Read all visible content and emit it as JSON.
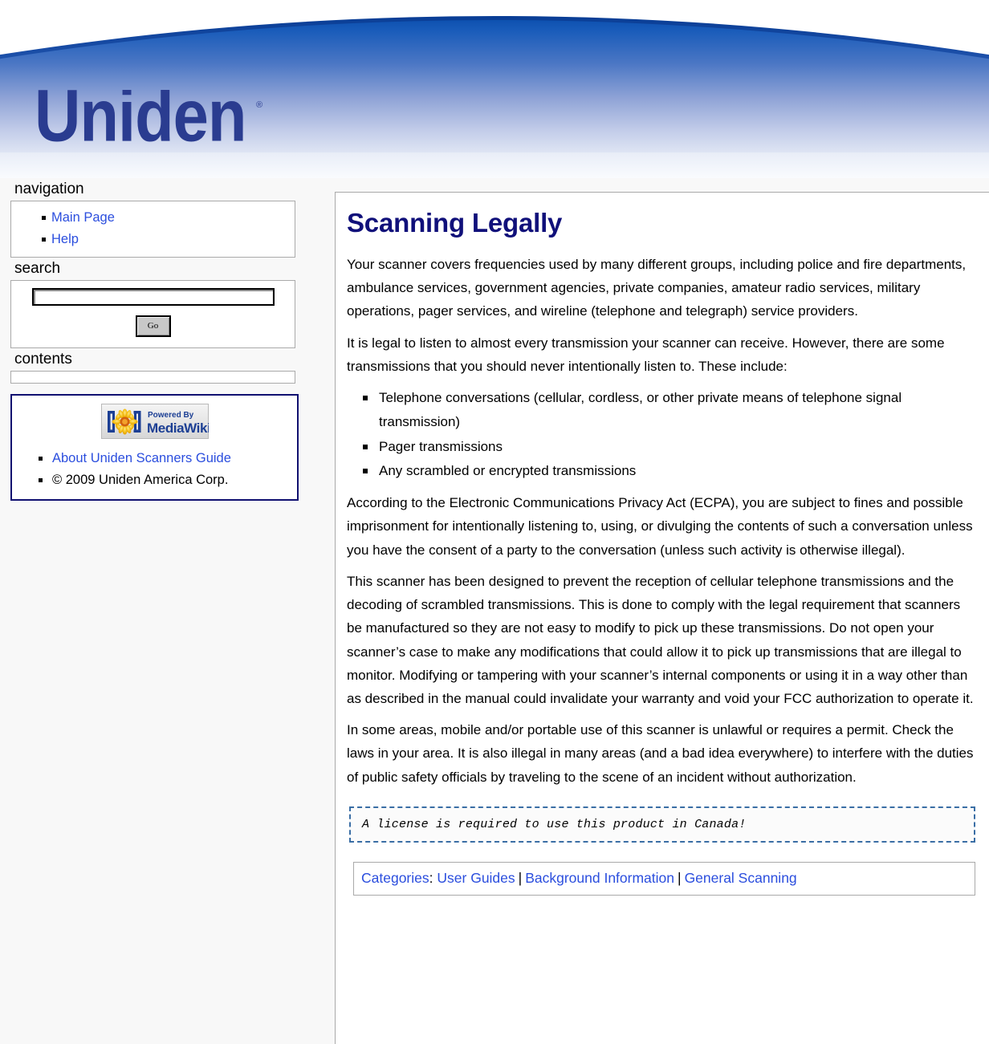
{
  "site": {
    "brand": "Uniden",
    "brand_trademark": "®"
  },
  "sidebar": {
    "navigation": {
      "heading": "navigation",
      "items": [
        {
          "label": "Main Page"
        },
        {
          "label": "Help"
        }
      ]
    },
    "search": {
      "heading": "search",
      "value": "",
      "placeholder": "",
      "go_label": "Go"
    },
    "contents": {
      "heading": "contents",
      "items": []
    },
    "footer_box": {
      "badge_alt": "Powered By MediaWiki",
      "badge_line1": "Powered By",
      "badge_line2": "MediaWiki",
      "items": [
        {
          "label": "About Uniden Scanners Guide",
          "is_link": true
        },
        {
          "label": "© 2009 Uniden America Corp.",
          "is_link": false
        }
      ]
    }
  },
  "content": {
    "title": "Scanning Legally",
    "paragraph_1": "Your scanner covers frequencies used by many different groups, including police and fire departments, ambulance services, government agencies, private companies, amateur radio services, military operations, pager services, and wireline (telephone and telegraph) service providers.",
    "paragraph_2": "It is legal to listen to almost every transmission your scanner can receive. However, there are some transmissions that you should never intentionally listen to. These include:",
    "prohibited_list": [
      "Telephone conversations (cellular, cordless, or other private means of telephone signal transmission)",
      "Pager transmissions",
      "Any scrambled or encrypted transmissions"
    ],
    "paragraph_3": "According to the Electronic Communications Privacy Act (ECPA), you are subject to fines and possible imprisonment for intentionally listening to, using, or divulging the contents of such a conversation unless you have the consent of a party to the conversation (unless such activity is otherwise illegal).",
    "paragraph_4": "This scanner has been designed to prevent the reception of cellular telephone transmissions and the decoding of scrambled transmissions. This is done to comply with the legal requirement that scanners be manufactured so they are not easy to modify to pick up these transmissions. Do not open your scanner’s case to make any modifications that could allow it to pick up transmissions that are illegal to monitor. Modifying or tampering with your scanner’s internal components or using it in a way other than as described in the manual could invalidate your warranty and void your FCC authorization to operate it.",
    "paragraph_5": "In some areas, mobile and/or portable use of this scanner is unlawful or requires a permit. Check the laws in your area. It is also illegal in many areas (and a bad idea everywhere) to interfere with the duties of public safety officials by traveling to the scene of an incident without authorization.",
    "license_note": "A license is required to use this product in Canada!"
  },
  "categories": {
    "label": "Categories",
    "colon": ":",
    "separator": "|",
    "items": [
      {
        "label": "User Guides"
      },
      {
        "label": "Background Information"
      },
      {
        "label": "General Scanning"
      }
    ]
  },
  "colors": {
    "banner_blue_dark": "#1258b8",
    "banner_blue_mid": "#7c97d4",
    "link_blue": "#2b4ede",
    "title_navy": "#10107a",
    "logo_navy": "#2a3c90",
    "border_gray": "#aaaaaa",
    "dashed_blue": "#3a6ea5",
    "footer_border_navy": "#101070"
  }
}
